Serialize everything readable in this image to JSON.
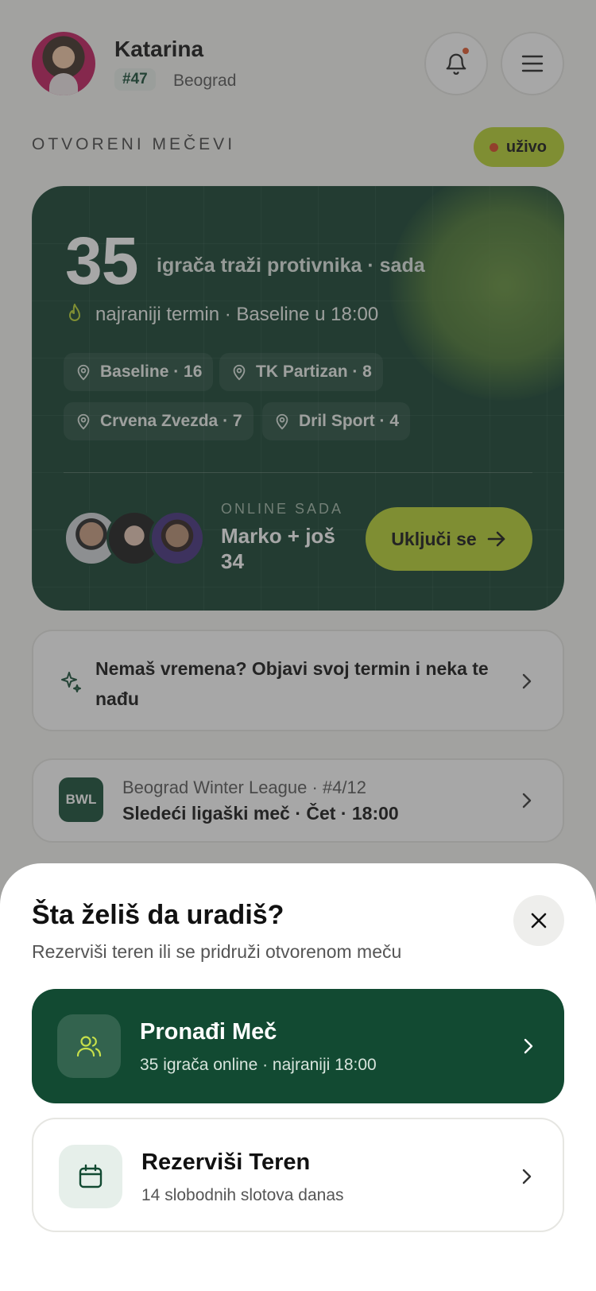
{
  "user": {
    "name": "Katarina",
    "rank": "#47",
    "city": "Beograd"
  },
  "section": {
    "title": "OTVORENI MEČEVI",
    "live_label": "uživo"
  },
  "hero": {
    "count": "35",
    "count_label": "igrača traži protivnika · sada",
    "earliest": "najraniji termin · Baseline u 18:00",
    "chips": [
      "Baseline · 16",
      "TK Partizan · 8",
      "Crvena Zvezda · 7",
      "Dril Sport · 4"
    ],
    "online_label": "ONLINE SADA",
    "online_names": "Marko + još 34",
    "join_label": "Uključi se"
  },
  "post_card": {
    "text": "Nemaš vremena? Objavi svoj termin i neka te nađu"
  },
  "league_card": {
    "badge": "BWL",
    "name": "Beograd Winter League · #4/12",
    "next": "Sledeći ligaški meč · Čet · 18:00"
  },
  "sheet": {
    "title": "Šta želiš da uradiš?",
    "subtitle": "Rezerviši teren ili se pridruži otvorenom meču",
    "actions": [
      {
        "title": "Pronađi Meč",
        "desc": "35 igrača online · najraniji 18:00"
      },
      {
        "title": "Rezerviši Teren",
        "desc": "14 slobodnih slotova danas"
      }
    ]
  },
  "colors": {
    "brand_green": "#124a32",
    "accent_lime": "#b7d22d",
    "live_red": "#d9421f"
  },
  "icons": [
    "bell-icon",
    "menu-icon",
    "flame-icon",
    "pin-icon",
    "arrow-right-icon",
    "sparkle-icon",
    "chevron-right-icon",
    "close-icon",
    "users-icon",
    "calendar-icon"
  ]
}
